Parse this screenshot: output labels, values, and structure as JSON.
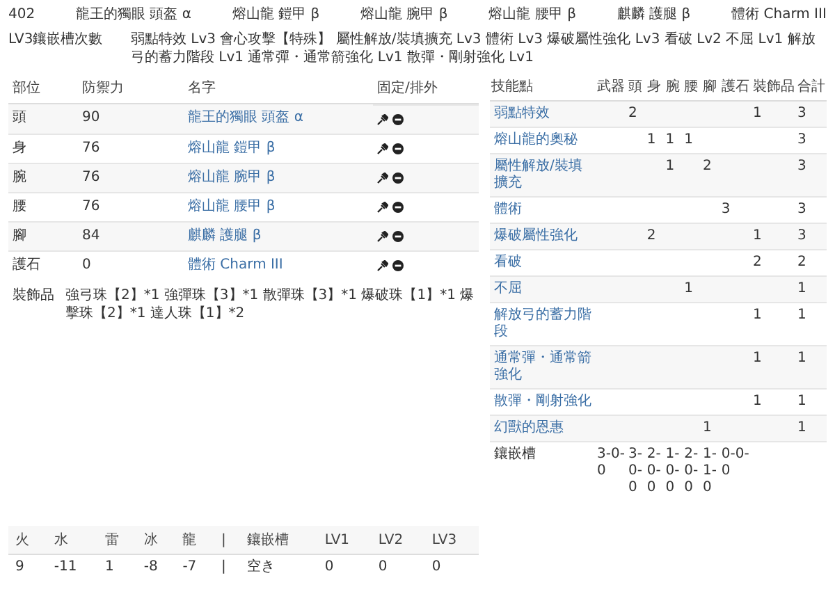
{
  "build_header": {
    "number": "402",
    "pieces": [
      "龍王的獨眼 頭盔 α",
      "熔山龍 鎧甲 β",
      "熔山龍 腕甲 β",
      "熔山龍 腰甲 β",
      "麒麟 護腿 β",
      "體術 Charm III"
    ]
  },
  "skills_summary": {
    "label": "LV3鑲嵌槽次數",
    "text": "弱點特效 Lv3 會心攻擊【特殊】 屬性解放/裝填擴充 Lv3 體術 Lv3 爆破屬性強化 Lv3 看破 Lv2 不屈 Lv1 解放弓的蓄力階段 Lv1 通常彈・通常箭強化 Lv1 散彈・剛射強化 Lv1"
  },
  "armor_table": {
    "columns": [
      "部位",
      "防禦力",
      "名字",
      "固定/排外"
    ],
    "rows": [
      {
        "part": "頭",
        "defense": "90",
        "name": "龍王的獨眼 頭盔 α"
      },
      {
        "part": "身",
        "defense": "76",
        "name": "熔山龍 鎧甲 β"
      },
      {
        "part": "腕",
        "defense": "76",
        "name": "熔山龍 腕甲 β"
      },
      {
        "part": "腰",
        "defense": "76",
        "name": "熔山龍 腰甲 β"
      },
      {
        "part": "腳",
        "defense": "84",
        "name": "麒麟 護腿 β"
      },
      {
        "part": "護石",
        "defense": "0",
        "name": "體術 Charm III"
      }
    ],
    "decorations": {
      "label": "裝飾品",
      "text": "強弓珠【2】*1 強彈珠【3】*1 散彈珠【3】*1 爆破珠【1】*1 爆擊珠【2】*1 達人珠【1】*2"
    }
  },
  "skill_table": {
    "columns": [
      "技能點",
      "武器",
      "頭",
      "身",
      "腕",
      "腰",
      "腳",
      "護石",
      "裝飾品",
      "合計"
    ],
    "rows": [
      {
        "kind": "skill",
        "cells": [
          "弱點特效",
          null,
          "2",
          null,
          null,
          null,
          null,
          null,
          "1",
          "3"
        ]
      },
      {
        "kind": "skill",
        "cells": [
          "熔山龍的奧秘",
          null,
          null,
          "1",
          "1",
          "1",
          null,
          null,
          null,
          "3"
        ]
      },
      {
        "kind": "skill",
        "cells": [
          "屬性解放/裝填擴充",
          null,
          null,
          null,
          "1",
          null,
          "2",
          null,
          null,
          "3"
        ]
      },
      {
        "kind": "skill",
        "cells": [
          "體術",
          null,
          null,
          null,
          null,
          null,
          null,
          "3",
          null,
          "3"
        ]
      },
      {
        "kind": "skill",
        "cells": [
          "爆破屬性強化",
          null,
          null,
          "2",
          null,
          null,
          null,
          null,
          "1",
          "3"
        ]
      },
      {
        "kind": "skill",
        "cells": [
          "看破",
          null,
          null,
          null,
          null,
          null,
          null,
          null,
          "2",
          "2"
        ]
      },
      {
        "kind": "skill",
        "cells": [
          "不屈",
          null,
          null,
          null,
          null,
          "1",
          null,
          null,
          null,
          "1"
        ]
      },
      {
        "kind": "skill",
        "cells": [
          "解放弓的蓄力階段",
          null,
          null,
          null,
          null,
          null,
          null,
          null,
          "1",
          "1"
        ]
      },
      {
        "kind": "skill",
        "cells": [
          "通常彈・通常箭強化",
          null,
          null,
          null,
          null,
          null,
          null,
          null,
          "1",
          "1"
        ]
      },
      {
        "kind": "skill",
        "cells": [
          "散彈・剛射強化",
          null,
          null,
          null,
          null,
          null,
          null,
          null,
          "1",
          "1"
        ]
      },
      {
        "kind": "skill",
        "cells": [
          "幻獸的恩惠",
          null,
          null,
          null,
          null,
          null,
          "1",
          null,
          null,
          "1"
        ]
      },
      {
        "kind": "slots",
        "cells": [
          "鑲嵌槽",
          "3-0-0",
          "3-0-0",
          "2-0-0",
          "1-0-0",
          "2-0-0",
          "1-1-0",
          "0-0-0",
          null,
          null
        ]
      }
    ]
  },
  "resist_table": {
    "columns": [
      "火",
      "水",
      "雷",
      "冰",
      "龍",
      "|",
      "鑲嵌槽",
      "LV1",
      "LV2",
      "LV3"
    ],
    "values": [
      "9",
      "-11",
      "1",
      "-8",
      "-7",
      "|",
      "空き",
      "0",
      "0",
      "0"
    ]
  }
}
